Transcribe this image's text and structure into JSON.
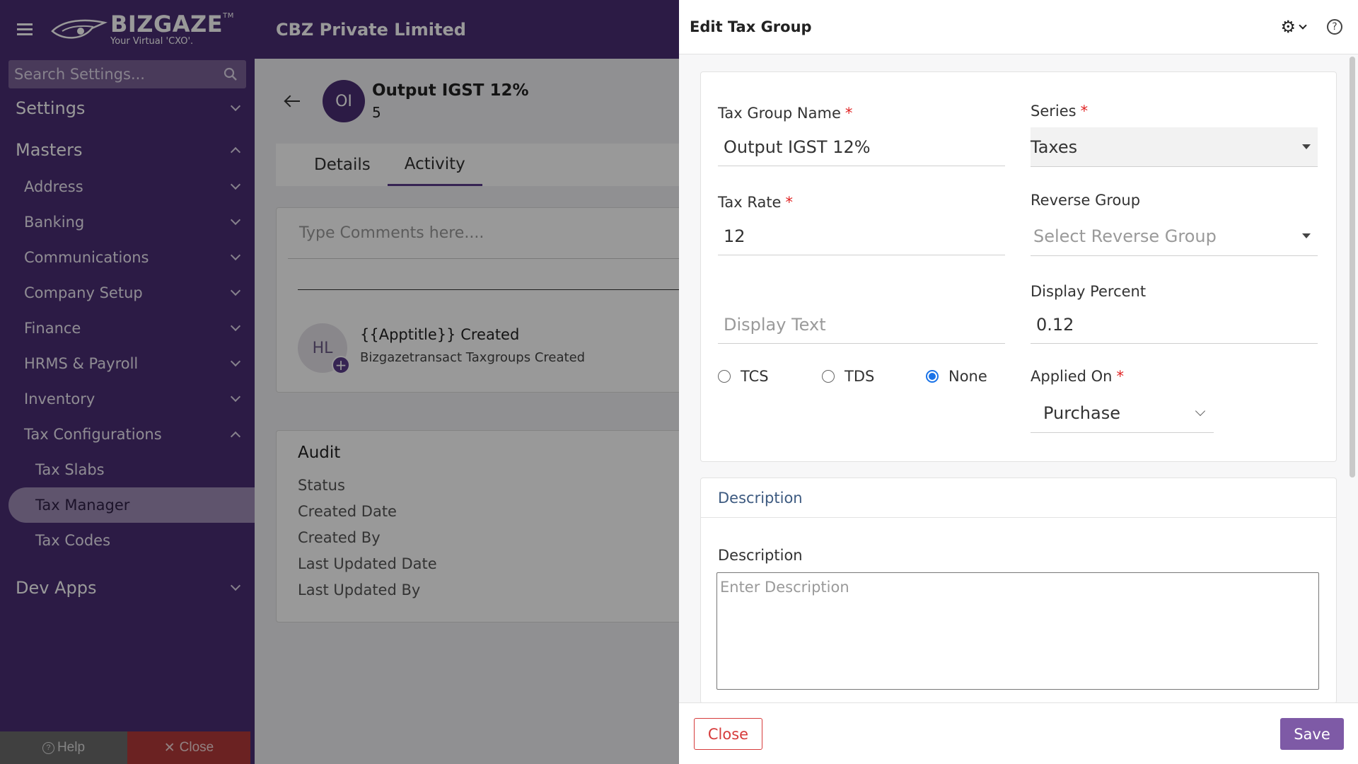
{
  "app": {
    "brand": "BIZGAZE",
    "trademark": "TM",
    "tagline": "Your Virtual 'CXO'.",
    "company": "CBZ Private Limited"
  },
  "sidebar": {
    "search_placeholder": "Search Settings...",
    "settings_label": "Settings",
    "masters_label": "Masters",
    "items": [
      {
        "label": "Address"
      },
      {
        "label": "Banking"
      },
      {
        "label": "Communications"
      },
      {
        "label": "Company Setup"
      },
      {
        "label": "Finance"
      },
      {
        "label": "HRMS & Payroll"
      },
      {
        "label": "Inventory"
      },
      {
        "label": "Tax Configurations"
      }
    ],
    "sub_items": [
      {
        "label": "Tax Slabs"
      },
      {
        "label": "Tax Manager"
      },
      {
        "label": "Tax Codes"
      }
    ],
    "dev_apps_label": "Dev Apps",
    "help_label": "Help",
    "close_label": "Close"
  },
  "record": {
    "avatar": "OI",
    "title": "Output IGST 12%",
    "subtitle": "5",
    "tabs": [
      {
        "label": "Details"
      },
      {
        "label": "Activity"
      }
    ],
    "comment_placeholder": "Type Comments here....",
    "activity": {
      "avatar": "HL",
      "title": "{{Apptitle}} Created",
      "desc": "Bizgazetransact Taxgroups Created"
    },
    "audit": {
      "title": "Audit",
      "rows": [
        "Status",
        "Created Date",
        "Created By",
        "Last Updated Date",
        "Last Updated By"
      ]
    }
  },
  "drawer": {
    "title": "Edit Tax Group",
    "fields": {
      "tax_group_name": {
        "label": "Tax Group Name",
        "value": "Output IGST 12%"
      },
      "series": {
        "label": "Series",
        "value": "Taxes"
      },
      "tax_rate": {
        "label": "Tax Rate",
        "value": "12"
      },
      "reverse_group": {
        "label": "Reverse Group",
        "placeholder": "Select Reverse Group"
      },
      "display_text": {
        "placeholder": "Display Text"
      },
      "display_percent": {
        "label": "Display Percent",
        "value": "0.12"
      },
      "applied_on": {
        "label": "Applied On",
        "value": "Purchase"
      }
    },
    "radios": [
      {
        "label": "TCS",
        "checked": false
      },
      {
        "label": "TDS",
        "checked": false
      },
      {
        "label": "None",
        "checked": true
      }
    ],
    "description_section": "Description",
    "description_label": "Description",
    "description_placeholder": "Enter Description",
    "close_label": "Close",
    "save_label": "Save",
    "required_mark": "*"
  }
}
